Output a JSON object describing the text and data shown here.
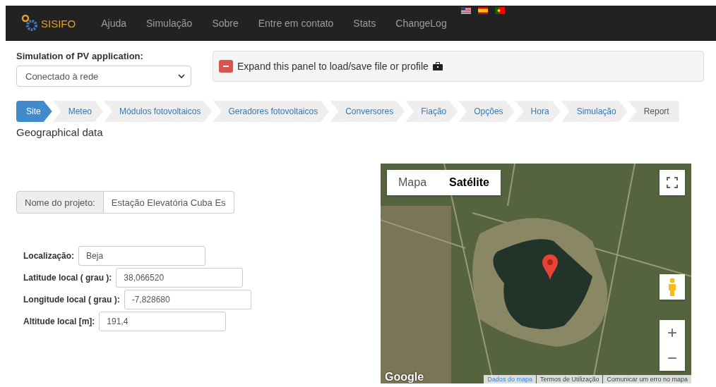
{
  "navbar": {
    "brand": "SISIFO",
    "links": [
      "Ajuda",
      "Simulação",
      "Sobre",
      "Entre em contato",
      "Stats",
      "ChangeLog"
    ],
    "flags": [
      {
        "kind": "us"
      },
      {
        "kind": "es"
      },
      {
        "kind": "pt"
      }
    ]
  },
  "application": {
    "label": "Simulation of PV application:",
    "value": "Conectado à rede"
  },
  "panel": {
    "text": "Expand this panel to load/save file or profile",
    "expanded": true
  },
  "tabs": [
    {
      "label": "Site",
      "selected": true
    },
    {
      "label": "Meteo",
      "selected": false
    },
    {
      "label": "Módulos fotovoltaicos",
      "selected": false
    },
    {
      "label": "Geradores fotovoltaicos",
      "selected": false
    },
    {
      "label": "Conversores",
      "selected": false
    },
    {
      "label": "Fiação",
      "selected": false
    },
    {
      "label": "Opções",
      "selected": false
    },
    {
      "label": "Hora",
      "selected": false
    },
    {
      "label": "Simulação",
      "selected": false
    },
    {
      "label": "Report",
      "selected": false
    }
  ],
  "section_title": "Geographical data",
  "project": {
    "label": "Nome do projeto:",
    "value": "Estação Elevatória Cuba Es"
  },
  "fields": [
    {
      "label": "Localização:",
      "value": "Beja"
    },
    {
      "label": "Latitude local ( grau ):",
      "value": "38,066520"
    },
    {
      "label": "Longitude local ( grau ):",
      "value": "-7,828680"
    },
    {
      "label": "Altitude local [m]:",
      "value": "191,4"
    }
  ],
  "map": {
    "types": [
      {
        "label": "Mapa",
        "selected": false
      },
      {
        "label": "Satélite",
        "selected": true
      }
    ],
    "logo": "Google",
    "zoom_in": "+",
    "zoom_out": "−",
    "footer": [
      "Dados do mapa",
      "Termos de Utilização",
      "Comunicar um erro no mapa"
    ]
  }
}
